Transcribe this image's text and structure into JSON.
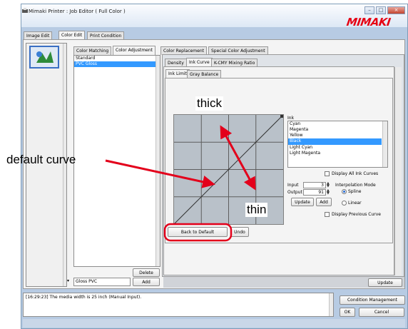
{
  "window": {
    "title": "Mimaki Printer : Job Editor ( Full Color )",
    "logo": "MIMAKI"
  },
  "main_tabs": [
    "Image Edit",
    "Color Edit",
    "Print Condition"
  ],
  "sub_tabs": [
    "Color Matching",
    "Color Adjustment",
    "Color Replacement",
    "Special Color Adjustment"
  ],
  "curve_tabs": [
    "Density",
    "Ink Curve",
    "K-CMY Mixing Ratio"
  ],
  "curve_subtabs": [
    "Ink Limit",
    "Gray Balance"
  ],
  "presets": [
    "Standard",
    "PVC Gloss"
  ],
  "preset_name": "Gloss PVC",
  "buttons": {
    "delete": "Delete",
    "add_left": "Add",
    "back_to_default": "Back to Default",
    "undo": "Undo",
    "update_small": "Update",
    "add_small": "Add",
    "update_bottom": "Update",
    "condition_management": "Condition Management",
    "ok": "OK",
    "cancel": "Cancel"
  },
  "ink": {
    "label": "Ink",
    "items": [
      "Cyan",
      "Magenta",
      "Yellow",
      "Black",
      "Light Cyan",
      "Light Magenta"
    ],
    "selected": "Black",
    "display_all_label": "Display All Ink Curves"
  },
  "controls": {
    "input_label": "Input",
    "input_value": "3",
    "output_label": "Output",
    "output_value": "91",
    "interp_label": "Interpolation Mode",
    "spline_label": "Spline",
    "linear_label": "Linear",
    "display_previous_label": "Display Previous Curve"
  },
  "status": {
    "message": "[16:29:23] The media width is 25 inch (Manual Input)."
  },
  "annotations": {
    "thick": "thick",
    "thin": "thin",
    "default_curve": "default curve",
    "color": "#e3001b"
  }
}
